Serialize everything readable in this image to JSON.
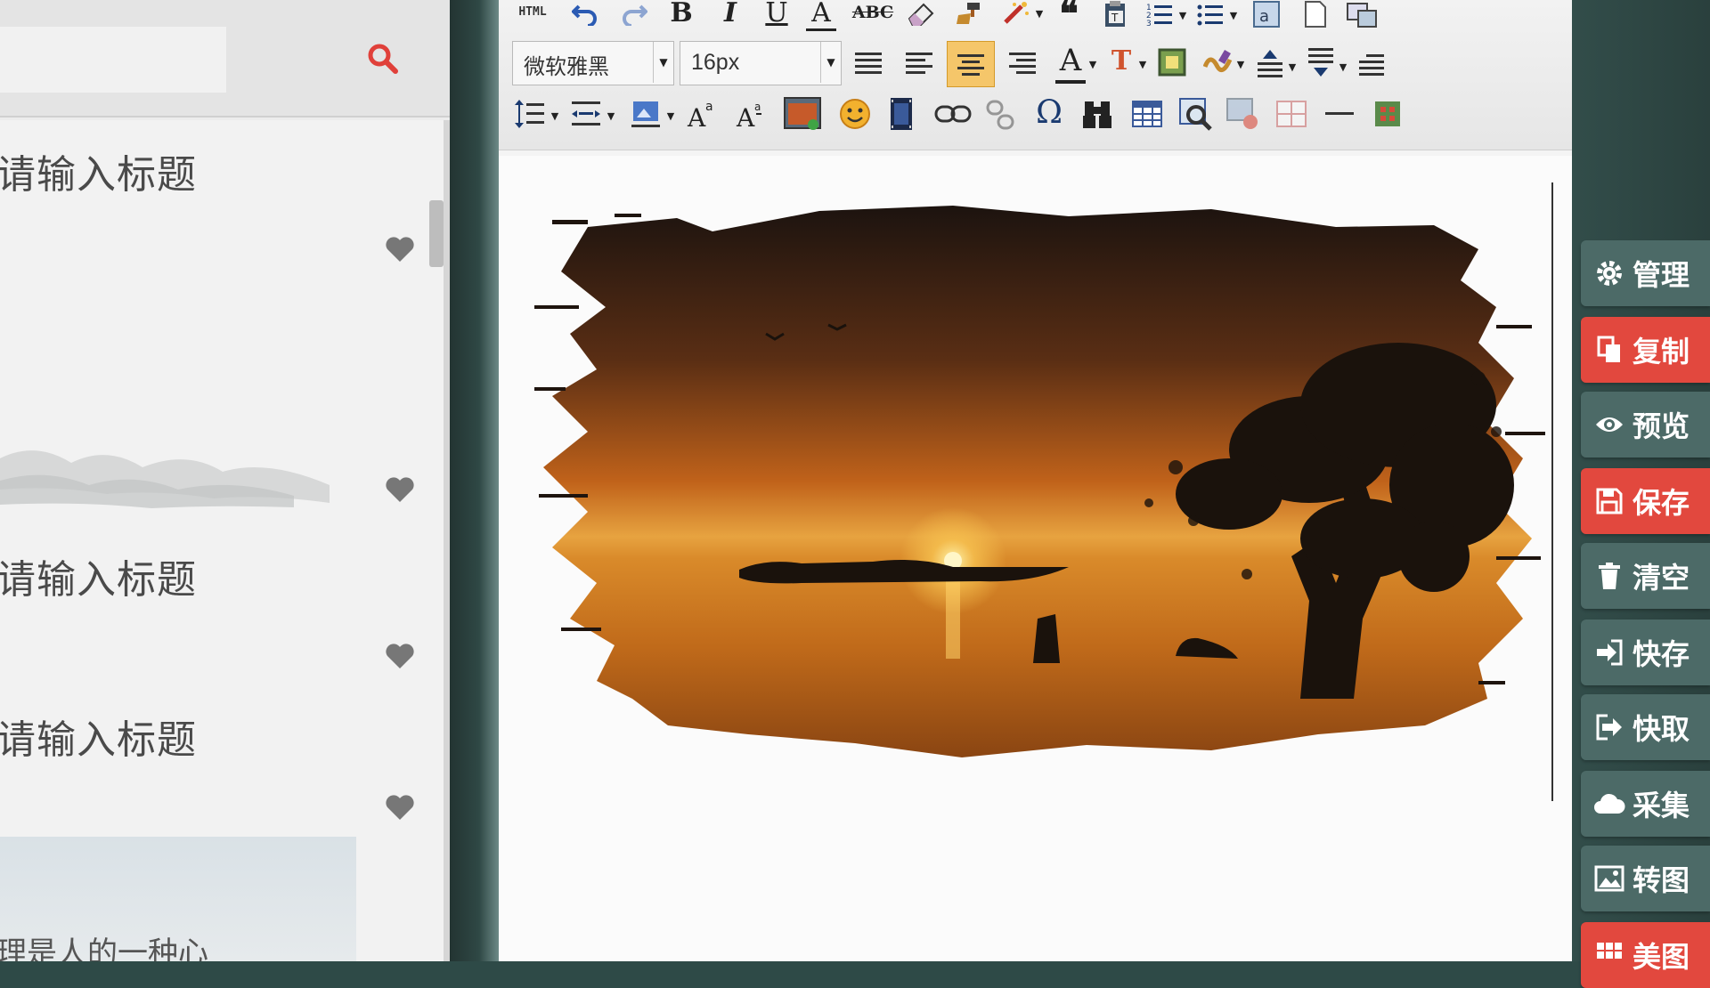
{
  "left_panel": {
    "search": {
      "placeholder": ""
    },
    "templates": [
      {
        "title": "请输入标题"
      },
      {
        "title": "请输入标题"
      },
      {
        "title": "请输入标题"
      }
    ],
    "partial_body_text": "理是人的一种心"
  },
  "toolbar": {
    "html_label": "HTML",
    "font_family_value": "微软雅黑",
    "font_size_value": "16px",
    "bold_label": "B",
    "italic_label": "I",
    "underline_label": "U",
    "font_border_label": "A",
    "strike_label": "ABC",
    "font_color_label": "A",
    "bg_color_label": "T",
    "special_char_label": "Ω",
    "row1_icons": [
      "html-icon",
      "undo-icon",
      "redo-icon",
      "bold-icon",
      "italic-icon",
      "underline-icon",
      "font-border-icon",
      "strikethrough-icon",
      "eraser-icon",
      "format-painter-icon",
      "auto-format-icon",
      "blockquote-icon",
      "paste-text-icon",
      "ordered-list-icon",
      "unordered-list-icon",
      "wordimage-icon",
      "new-page-icon",
      "preview-icon"
    ],
    "row2_icons": [
      "font-family-select",
      "font-size-select",
      "justify-icon",
      "align-left-icon",
      "align-center-icon",
      "align-right-icon",
      "font-color-icon",
      "background-color-icon",
      "insert-image-frame-icon",
      "highlight-icon",
      "para-spacing-top-icon",
      "para-spacing-bottom-icon",
      "indent-icon"
    ],
    "row3_icons": [
      "line-height-icon",
      "spacing-icon",
      "image-align-icon",
      "superscript-icon",
      "subscript-icon",
      "insert-image-icon",
      "emotion-icon",
      "insert-video-icon",
      "link-icon",
      "unlink-icon",
      "special-char-icon",
      "search-replace-icon",
      "insert-table-icon",
      "map-icon",
      "insert-frame-icon",
      "table-delete-icon",
      "horizontal-rule-icon",
      "snapscreen-icon"
    ],
    "active_button": "align-center"
  },
  "actions": [
    {
      "label": "管理",
      "icon": "gear-icon",
      "color": "dark"
    },
    {
      "label": "复制",
      "icon": "copy-icon",
      "color": "red"
    },
    {
      "label": "预览",
      "icon": "eye-icon",
      "color": "dark"
    },
    {
      "label": "保存",
      "icon": "save-icon",
      "color": "red"
    },
    {
      "label": "清空",
      "icon": "trash-icon",
      "color": "dark"
    },
    {
      "label": "快存",
      "icon": "sign-in-icon",
      "color": "dark"
    },
    {
      "label": "快取",
      "icon": "sign-out-icon",
      "color": "dark"
    },
    {
      "label": "采集",
      "icon": "cloud-icon",
      "color": "dark"
    },
    {
      "label": "转图",
      "icon": "picture-icon",
      "color": "dark"
    },
    {
      "label": "美图",
      "icon": "grid-icon",
      "color": "red"
    }
  ],
  "colors": {
    "accent_red": "#e2483e",
    "sidebar_button": "#4c6a67",
    "search_icon": "#e0403a",
    "active_toolbar": "#f5c66a"
  }
}
